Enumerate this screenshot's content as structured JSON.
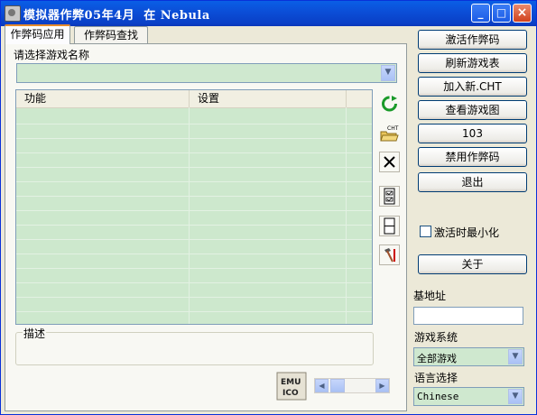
{
  "window": {
    "title": "模拟器作弊05年4月  在 Nebula",
    "minimize": "_",
    "maximize": "□",
    "close": "×"
  },
  "tabs": [
    {
      "label": "作弊码应用"
    },
    {
      "label": "作弊码查找"
    }
  ],
  "game_select": {
    "label": "请选择游戏名称",
    "value": ""
  },
  "cheat_list": {
    "columns": [
      "功能",
      "设置"
    ]
  },
  "side_tools": [
    "refresh-icon",
    "open-cht-icon",
    "delete-icon",
    "check-list-icon",
    "blank-page-icon",
    "tools-icon"
  ],
  "buttons": {
    "activate": "激活作弊码",
    "refresh_list": "刷新游戏表",
    "add_cht": "加入新.CHT",
    "view_game_image": "查看游戏图",
    "count": "103",
    "disable": "禁用作弊码",
    "exit": "退出",
    "about": "关于"
  },
  "minimize_on_activate": {
    "label": "激活时最小化",
    "checked": false
  },
  "base_address": {
    "label": "基地址",
    "value": ""
  },
  "game_system": {
    "label": "游戏系统",
    "value": "全部游戏"
  },
  "language": {
    "label": "语言选择",
    "value": "Chinese"
  },
  "description": {
    "label": "描述"
  },
  "emu_icon_text": "EMU ICO",
  "colors": {
    "titlebar": "#0a5fe6",
    "list_bg": "#cde8cd",
    "window_bg": "#ece9d8"
  }
}
